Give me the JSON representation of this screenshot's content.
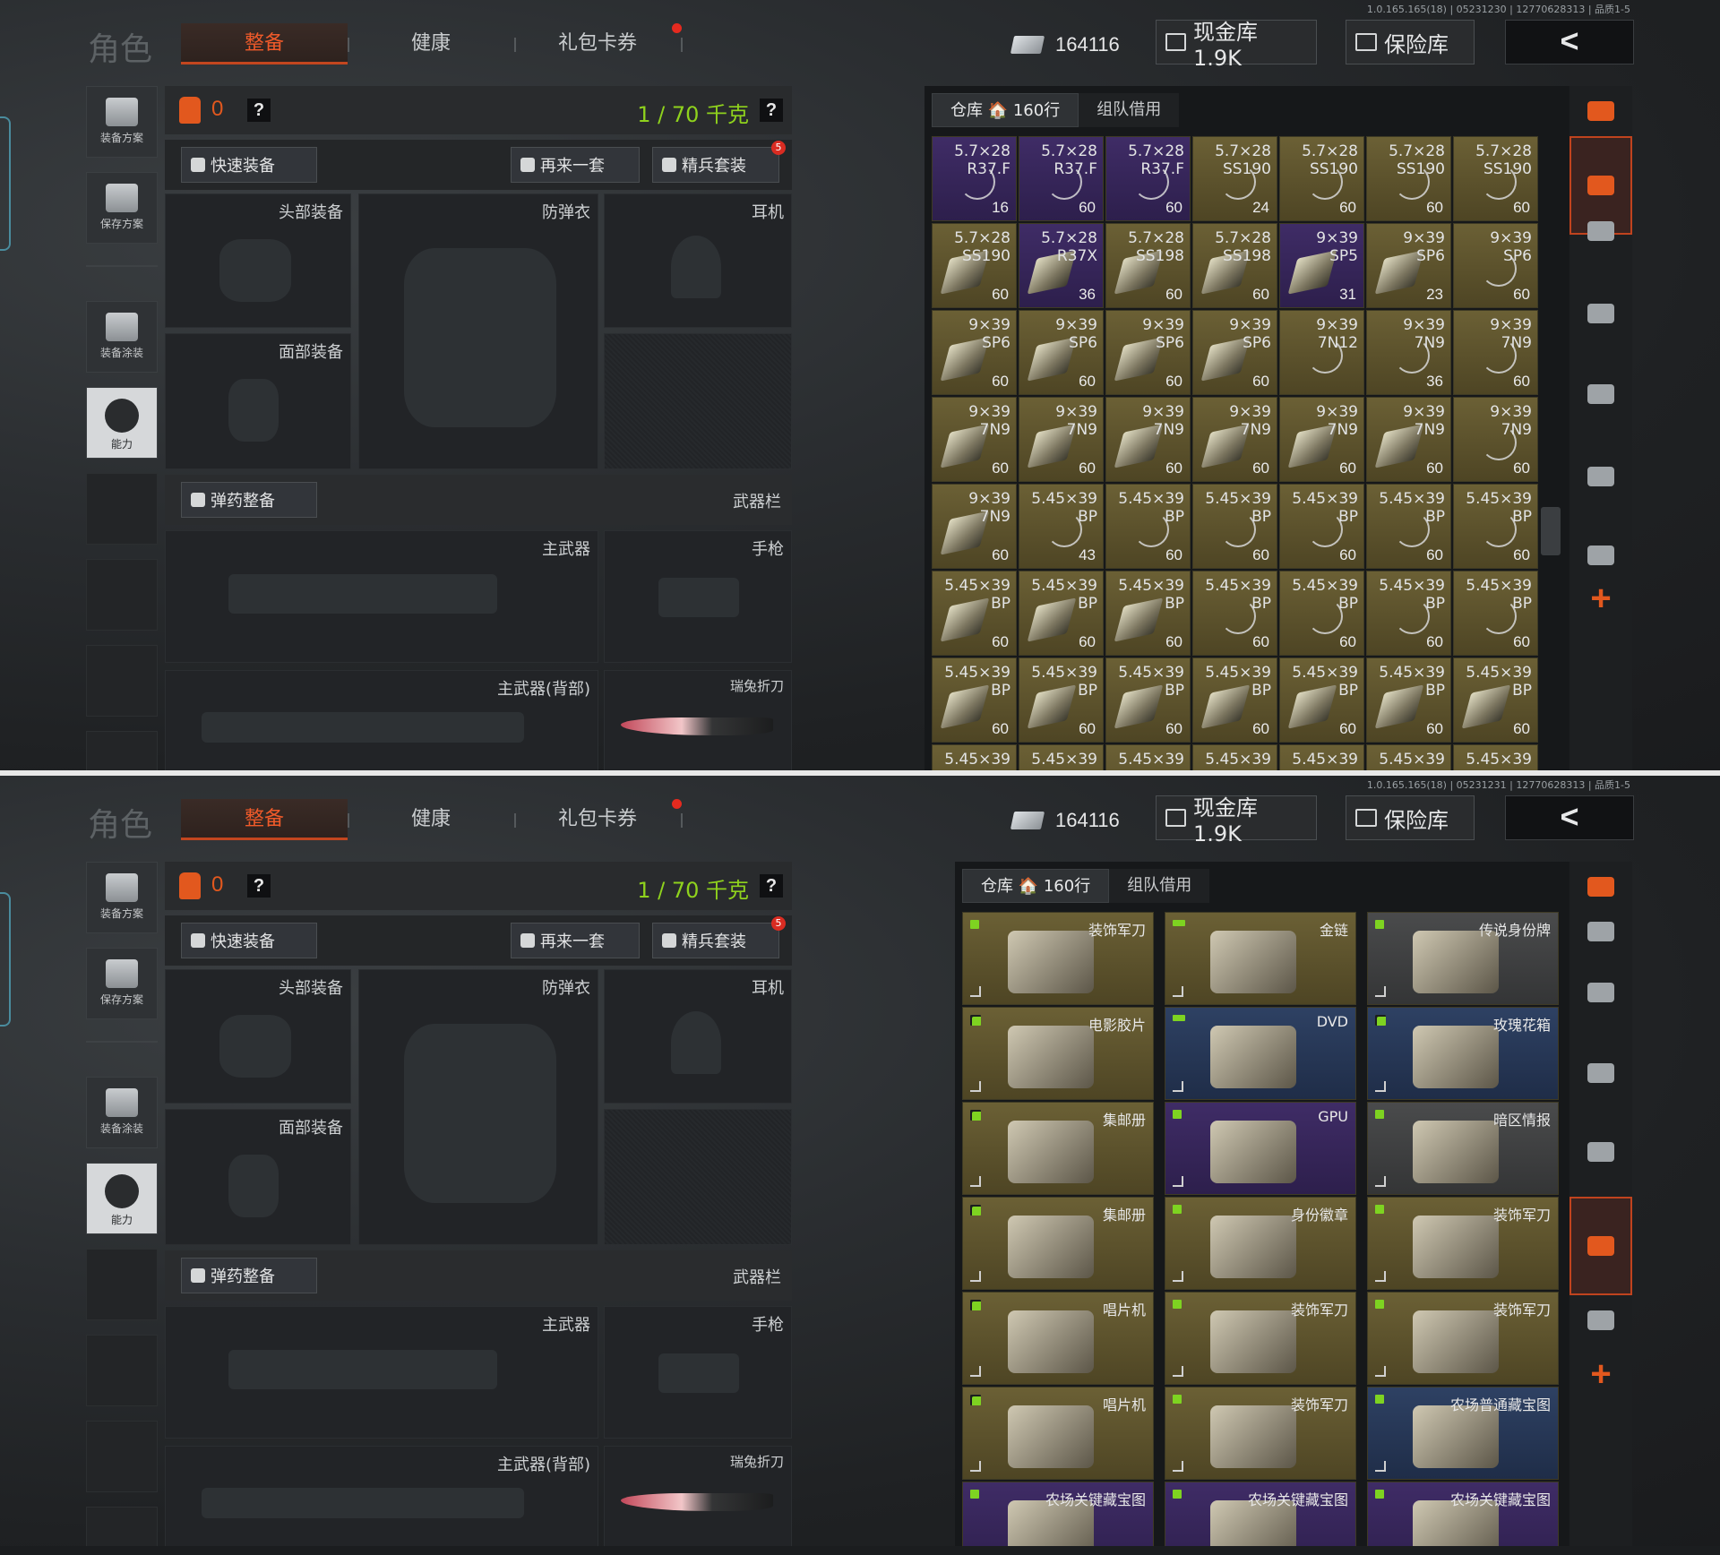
{
  "header": {
    "version_a": "1.0.165.165(18) | 05231230 | 12770628313 | 品质1-5",
    "version_b": "1.0.165.165(18) | 05231231 | 12770628313 | 品质1-5",
    "role": "角色",
    "tabs": [
      "整备",
      "健康",
      "礼包卡券"
    ],
    "money": "164116",
    "cash_vault": "现金库 1.9K",
    "safe": "保险库",
    "back": "<"
  },
  "sidebar": {
    "items": [
      "装备方案",
      "保存方案",
      "装备涂装",
      "能力"
    ]
  },
  "loadout": {
    "bag_count": "0",
    "qmark": "?",
    "weight": "1 / 70 千克",
    "quick_equip": "快速装备",
    "again": "再来一套",
    "elite": "精兵套装",
    "elite_badge": "5",
    "slots": {
      "head": "头部装备",
      "armor": "防弹衣",
      "ear": "耳机",
      "face": "面部装备",
      "ammo": "弹药整备",
      "weapon_bar": "武器栏",
      "primary": "主武器",
      "pistol": "手枪",
      "primary_back": "主武器(背部)",
      "knife": "瑞兔折刀"
    }
  },
  "stash": {
    "tab_warehouse": "仓库 🏠 160行",
    "tab_team": "组队借用"
  },
  "ammo_cells": [
    {
      "cal": "5.7×28",
      "type": "R37.F",
      "qty": "16",
      "rarity": "purple"
    },
    {
      "cal": "5.7×28",
      "type": "R37.F",
      "qty": "60",
      "rarity": "purple"
    },
    {
      "cal": "5.7×28",
      "type": "R37.F",
      "qty": "60",
      "rarity": "purple"
    },
    {
      "cal": "5.7×28",
      "type": "SS190",
      "qty": "24",
      "rarity": "gold"
    },
    {
      "cal": "5.7×28",
      "type": "SS190",
      "qty": "60",
      "rarity": "gold"
    },
    {
      "cal": "5.7×28",
      "type": "SS190",
      "qty": "60",
      "rarity": "gold"
    },
    {
      "cal": "5.7×28",
      "type": "SS190",
      "qty": "60",
      "rarity": "gold"
    },
    {
      "cal": "5.7×28",
      "type": "SS190",
      "qty": "60",
      "rarity": "gold",
      "box": true
    },
    {
      "cal": "5.7×28",
      "type": "R37X",
      "qty": "36",
      "rarity": "purple",
      "box": true
    },
    {
      "cal": "5.7×28",
      "type": "SS198",
      "qty": "60",
      "rarity": "gold",
      "box": true
    },
    {
      "cal": "5.7×28",
      "type": "SS198",
      "qty": "60",
      "rarity": "gold",
      "box": true
    },
    {
      "cal": "9×39",
      "type": "SP5",
      "qty": "31",
      "rarity": "purple",
      "box": true
    },
    {
      "cal": "9×39",
      "type": "SP6",
      "qty": "23",
      "rarity": "gold",
      "box": true
    },
    {
      "cal": "9×39",
      "type": "SP6",
      "qty": "60",
      "rarity": "gold"
    },
    {
      "cal": "9×39",
      "type": "SP6",
      "qty": "60",
      "rarity": "gold",
      "box": true
    },
    {
      "cal": "9×39",
      "type": "SP6",
      "qty": "60",
      "rarity": "gold",
      "box": true
    },
    {
      "cal": "9×39",
      "type": "SP6",
      "qty": "60",
      "rarity": "gold",
      "box": true
    },
    {
      "cal": "9×39",
      "type": "SP6",
      "qty": "60",
      "rarity": "gold",
      "box": true
    },
    {
      "cal": "9×39",
      "type": "7N12",
      "qty": "",
      "rarity": "gold"
    },
    {
      "cal": "9×39",
      "type": "7N9",
      "qty": "36",
      "rarity": "gold"
    },
    {
      "cal": "9×39",
      "type": "7N9",
      "qty": "60",
      "rarity": "gold"
    },
    {
      "cal": "9×39",
      "type": "7N9",
      "qty": "60",
      "rarity": "gold",
      "box": true
    },
    {
      "cal": "9×39",
      "type": "7N9",
      "qty": "60",
      "rarity": "gold",
      "box": true
    },
    {
      "cal": "9×39",
      "type": "7N9",
      "qty": "60",
      "rarity": "gold",
      "box": true
    },
    {
      "cal": "9×39",
      "type": "7N9",
      "qty": "60",
      "rarity": "gold",
      "box": true
    },
    {
      "cal": "9×39",
      "type": "7N9",
      "qty": "60",
      "rarity": "gold",
      "box": true
    },
    {
      "cal": "9×39",
      "type": "7N9",
      "qty": "60",
      "rarity": "gold",
      "box": true
    },
    {
      "cal": "9×39",
      "type": "7N9",
      "qty": "60",
      "rarity": "gold"
    },
    {
      "cal": "9×39",
      "type": "7N9",
      "qty": "60",
      "rarity": "gold",
      "box": true
    },
    {
      "cal": "5.45×39",
      "type": "BP",
      "qty": "43",
      "rarity": "gold"
    },
    {
      "cal": "5.45×39",
      "type": "BP",
      "qty": "60",
      "rarity": "gold"
    },
    {
      "cal": "5.45×39",
      "type": "BP",
      "qty": "60",
      "rarity": "gold"
    },
    {
      "cal": "5.45×39",
      "type": "BP",
      "qty": "60",
      "rarity": "gold"
    },
    {
      "cal": "5.45×39",
      "type": "BP",
      "qty": "60",
      "rarity": "gold"
    },
    {
      "cal": "5.45×39",
      "type": "BP",
      "qty": "60",
      "rarity": "gold"
    },
    {
      "cal": "5.45×39",
      "type": "BP",
      "qty": "60",
      "rarity": "gold",
      "box": true
    },
    {
      "cal": "5.45×39",
      "type": "BP",
      "qty": "60",
      "rarity": "gold",
      "box": true
    },
    {
      "cal": "5.45×39",
      "type": "BP",
      "qty": "60",
      "rarity": "gold",
      "box": true
    },
    {
      "cal": "5.45×39",
      "type": "BP",
      "qty": "60",
      "rarity": "gold"
    },
    {
      "cal": "5.45×39",
      "type": "BP",
      "qty": "60",
      "rarity": "gold"
    },
    {
      "cal": "5.45×39",
      "type": "BP",
      "qty": "60",
      "rarity": "gold"
    },
    {
      "cal": "5.45×39",
      "type": "BP",
      "qty": "60",
      "rarity": "gold"
    },
    {
      "cal": "5.45×39",
      "type": "BP",
      "qty": "60",
      "rarity": "gold",
      "box": true
    },
    {
      "cal": "5.45×39",
      "type": "BP",
      "qty": "60",
      "rarity": "gold",
      "box": true
    },
    {
      "cal": "5.45×39",
      "type": "BP",
      "qty": "60",
      "rarity": "gold",
      "box": true
    },
    {
      "cal": "5.45×39",
      "type": "BP",
      "qty": "60",
      "rarity": "gold",
      "box": true
    },
    {
      "cal": "5.45×39",
      "type": "BP",
      "qty": "60",
      "rarity": "gold",
      "box": true
    },
    {
      "cal": "5.45×39",
      "type": "BP",
      "qty": "60",
      "rarity": "gold",
      "box": true
    },
    {
      "cal": "5.45×39",
      "type": "BP",
      "qty": "60",
      "rarity": "gold",
      "box": true
    },
    {
      "cal": "5.45×39",
      "type": "",
      "qty": "",
      "rarity": "gold"
    },
    {
      "cal": "5.45×39",
      "type": "",
      "qty": "",
      "rarity": "gold"
    },
    {
      "cal": "5.45×39",
      "type": "",
      "qty": "",
      "rarity": "gold"
    },
    {
      "cal": "5.45×39",
      "type": "",
      "qty": "",
      "rarity": "gold"
    },
    {
      "cal": "5.45×39",
      "type": "",
      "qty": "",
      "rarity": "gold"
    },
    {
      "cal": "5.45×39",
      "type": "",
      "qty": "",
      "rarity": "gold"
    },
    {
      "cal": "5.45×39",
      "type": "",
      "qty": "",
      "rarity": "gold"
    }
  ],
  "item_cells": [
    {
      "name": "装饰军刀",
      "rarity": "gold",
      "tag": "single"
    },
    {
      "name": "金链",
      "rarity": "gold",
      "tag": "double"
    },
    {
      "name": "传说身份牌",
      "rarity": "gray",
      "tag": "single"
    },
    {
      "name": "电影胶片",
      "rarity": "gold",
      "tag": "quad"
    },
    {
      "name": "DVD",
      "rarity": "blue",
      "tag": "double"
    },
    {
      "name": "玫瑰花箱",
      "rarity": "blue",
      "tag": "quad"
    },
    {
      "name": "集邮册",
      "rarity": "gold",
      "tag": "quad"
    },
    {
      "name": "GPU",
      "rarity": "purple",
      "tag": "single"
    },
    {
      "name": "暗区情报",
      "rarity": "gray",
      "tag": "single"
    },
    {
      "name": "集邮册",
      "rarity": "gold",
      "tag": "quad"
    },
    {
      "name": "身份徽章",
      "rarity": "gold",
      "tag": "single"
    },
    {
      "name": "装饰军刀",
      "rarity": "gold",
      "tag": "single"
    },
    {
      "name": "唱片机",
      "rarity": "gold",
      "tag": "quad"
    },
    {
      "name": "装饰军刀",
      "rarity": "gold",
      "tag": "single"
    },
    {
      "name": "装饰军刀",
      "rarity": "gold",
      "tag": "single"
    },
    {
      "name": "唱片机",
      "rarity": "gold",
      "tag": "quad"
    },
    {
      "name": "装饰军刀",
      "rarity": "gold",
      "tag": "single"
    },
    {
      "name": "农场普通藏宝图",
      "rarity": "blue",
      "tag": "single"
    },
    {
      "name": "农场关键藏宝图",
      "rarity": "purple",
      "tag": "single"
    },
    {
      "name": "农场关键藏宝图",
      "rarity": "purple",
      "tag": "single"
    },
    {
      "name": "农场关键藏宝图",
      "rarity": "purple",
      "tag": "single"
    }
  ],
  "colors": {
    "accent": "#e2581e",
    "weight_green": "#8fd21d",
    "gold": "#6b6035",
    "purple": "#3f2c66",
    "blue": "#2e4163"
  },
  "icons": {
    "cash": "banknote-icon",
    "vault": "safe-icon",
    "back": "chevron-left-icon",
    "bag": "backpack-icon"
  }
}
